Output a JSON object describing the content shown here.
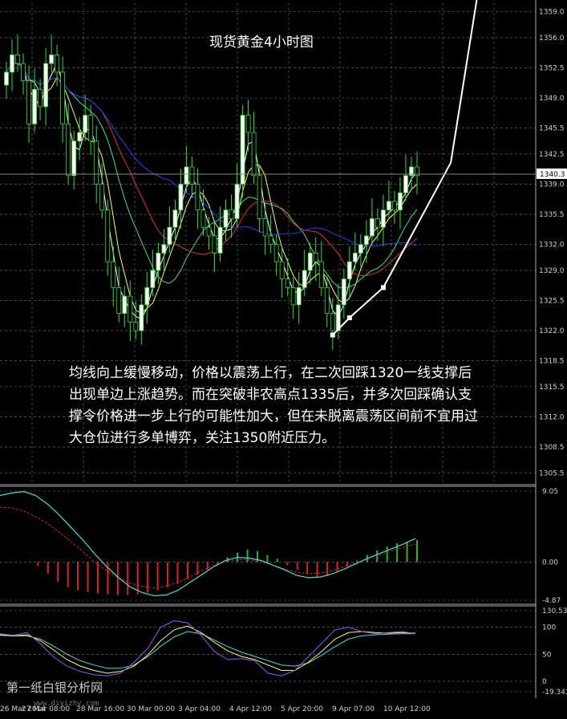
{
  "chart_data": [
    {
      "type": "candlestick",
      "title": "现货黄金4小时图",
      "ylim": [
        1304.5,
        1360.0
      ],
      "y_ticks": [
        "1359.0",
        "1356.0",
        "1352.5",
        "1349.0",
        "1345.5",
        "1342.5",
        "1339.0",
        "1335.5",
        "1332.0",
        "1329.0",
        "1325.5",
        "1322.0",
        "1318.5",
        "1315.5",
        "1312.0",
        "1308.5",
        "1305.5"
      ],
      "current_price": "1340.3",
      "x_ticks": [
        "26 Mar 2014",
        "27 Mar 08:00",
        "28 Mar 16:00",
        "30 Mar 00:00",
        "3 Apr 04:00",
        "4 Apr 12:00",
        "5 Apr 20:00",
        "9 Apr 07:00",
        "10 Apr 12:00"
      ],
      "closes": [
        1352,
        1354,
        1353,
        1351,
        1346,
        1350,
        1348,
        1353,
        1354,
        1352,
        1346,
        1340,
        1344,
        1345,
        1347,
        1344,
        1339,
        1336,
        1330,
        1327,
        1324,
        1326,
        1323,
        1322,
        1325,
        1327,
        1329,
        1331,
        1332,
        1334,
        1336,
        1339,
        1341,
        1339,
        1336,
        1334,
        1333,
        1331,
        1334,
        1336,
        1335,
        1339,
        1347,
        1345,
        1340,
        1335,
        1333,
        1332,
        1330,
        1328,
        1327,
        1325,
        1327,
        1329,
        1331,
        1330,
        1327,
        1324,
        1322,
        1325,
        1328,
        1330,
        1331,
        1332,
        1333,
        1335,
        1334,
        1336,
        1337,
        1336,
        1338,
        1340,
        1341,
        1340
      ],
      "support_line": [
        [
          58,
          1321.5
        ],
        [
          61,
          1323.5
        ],
        [
          67,
          1327.0
        ],
        [
          79,
          1341.5
        ],
        [
          84,
          1362.0
        ]
      ],
      "ma_colors": [
        "#ffffff",
        "#ffff55",
        "#44dd88",
        "#e03030",
        "#2040ff"
      ]
    },
    {
      "type": "macd",
      "y_ticks": [
        "9.05",
        "0.00",
        "-4.87"
      ],
      "histogram": [
        0,
        0,
        0,
        -0.5,
        -1.5,
        -2.5,
        -3.2,
        -3.6,
        -3.8,
        -4.0,
        -4.1,
        -4.2,
        -4.2,
        -4.1,
        -3.9,
        -3.6,
        -3.2,
        -2.8,
        -2.2,
        -1.6,
        -1.0,
        -0.2,
        0.6,
        1.2,
        1.6,
        1.4,
        0.9,
        0.4,
        -0.4,
        -1.0,
        -1.5,
        -2.0,
        -1.8,
        -1.3,
        -0.6,
        0.2,
        0.9,
        1.5,
        2.0,
        2.4,
        2.6,
        2.8
      ],
      "macd_line": [
        8.5,
        8.8,
        9.0,
        8.5,
        7.4,
        6.0,
        4.4,
        2.8,
        1.0,
        -0.6,
        -2.0,
        -3.2,
        -3.9,
        -4.3,
        -4.2,
        -3.6,
        -2.6,
        -1.6,
        -0.6,
        0.2,
        0.6,
        0.5,
        0.2,
        -0.4,
        -1.0,
        -1.7,
        -2.0,
        -1.9,
        -1.5,
        -0.9,
        -0.2,
        0.5,
        1.1,
        1.7,
        2.3,
        3.0
      ],
      "signal_line": [
        7.0,
        6.9,
        6.5,
        5.8,
        4.9,
        3.8,
        2.6,
        1.3,
        0.0,
        -1.1,
        -2.0,
        -2.7,
        -3.1,
        -3.3,
        -3.1,
        -2.6,
        -1.9,
        -1.1,
        -0.4,
        0.1,
        0.3,
        0.3,
        0.0,
        -0.4,
        -0.9,
        -1.3,
        -1.5,
        -1.4,
        -1.1,
        -0.6,
        -0.1,
        0.4,
        0.9,
        1.4,
        1.9,
        2.3
      ]
    },
    {
      "type": "stochastic",
      "y_ticks": [
        "130.531",
        "100",
        "50",
        "0",
        "-19.343"
      ],
      "k_line": [
        88,
        85,
        90,
        70,
        45,
        28,
        18,
        12,
        10,
        15,
        35,
        60,
        100,
        112,
        108,
        85,
        55,
        40,
        42,
        38,
        15,
        10,
        20,
        45,
        70,
        95,
        100,
        92,
        88,
        90,
        92,
        88
      ],
      "d_line": [
        86,
        84,
        86,
        75,
        58,
        40,
        28,
        20,
        15,
        18,
        28,
        48,
        75,
        95,
        102,
        90,
        72,
        56,
        46,
        40,
        30,
        20,
        20,
        35,
        55,
        78,
        90,
        92,
        90,
        89,
        90,
        89
      ],
      "slow_line": [
        85,
        84,
        84,
        78,
        65,
        50,
        38,
        30,
        24,
        24,
        30,
        45,
        65,
        82,
        92,
        88,
        76,
        64,
        54,
        46,
        38,
        30,
        28,
        34,
        48,
        64,
        78,
        84,
        86,
        87,
        88,
        88
      ]
    }
  ],
  "annotation": {
    "text": "均线向上缓慢移动，价格以震荡上行，在二次回踩1320一线支撑后出现单边上涨趋势。而在突破非农高点1335后，并多次回踩确认支撑令价格进一步上行的可能性加大，但在未脱离震荡区间前不宜用过大仓位进行多单博弈，关注1350附近压力。"
  },
  "watermark": {
    "text": "第一纸白银分析网",
    "url": "www.diyizhy.com"
  }
}
